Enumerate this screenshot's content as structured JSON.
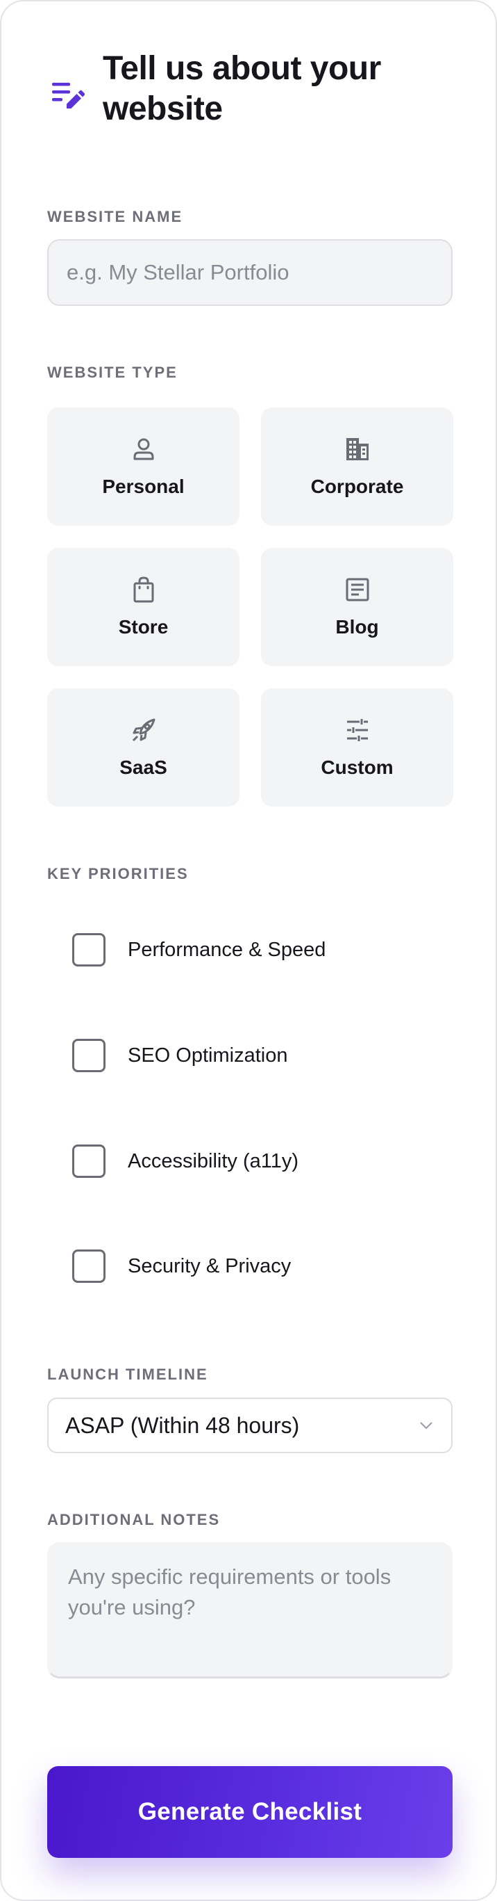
{
  "header": {
    "title": "Tell us about your website",
    "icon": "notes-edit-icon",
    "accent_color": "#5b33d6"
  },
  "website_name": {
    "label": "WEBSITE NAME",
    "value": "",
    "placeholder": "e.g. My Stellar Portfolio"
  },
  "website_type": {
    "label": "WEBSITE TYPE",
    "options": [
      {
        "label": "Personal",
        "icon": "person-icon"
      },
      {
        "label": "Corporate",
        "icon": "building-icon"
      },
      {
        "label": "Store",
        "icon": "shopping-bag-icon"
      },
      {
        "label": "Blog",
        "icon": "article-icon"
      },
      {
        "label": "SaaS",
        "icon": "rocket-icon"
      },
      {
        "label": "Custom",
        "icon": "sliders-icon"
      }
    ]
  },
  "priorities": {
    "label": "KEY PRIORITIES",
    "items": [
      {
        "label": "Performance & Speed",
        "checked": false
      },
      {
        "label": "SEO Optimization",
        "checked": false
      },
      {
        "label": "Accessibility (a11y)",
        "checked": false
      },
      {
        "label": "Security & Privacy",
        "checked": false
      }
    ]
  },
  "timeline": {
    "label": "LAUNCH TIMELINE",
    "selected": "ASAP (Within 48 hours)"
  },
  "notes": {
    "label": "ADDITIONAL NOTES",
    "value": "",
    "placeholder": "Any specific requirements or tools you're using?"
  },
  "actions": {
    "generate_label": "Generate Checklist",
    "button_color": "#4f1fd4"
  }
}
